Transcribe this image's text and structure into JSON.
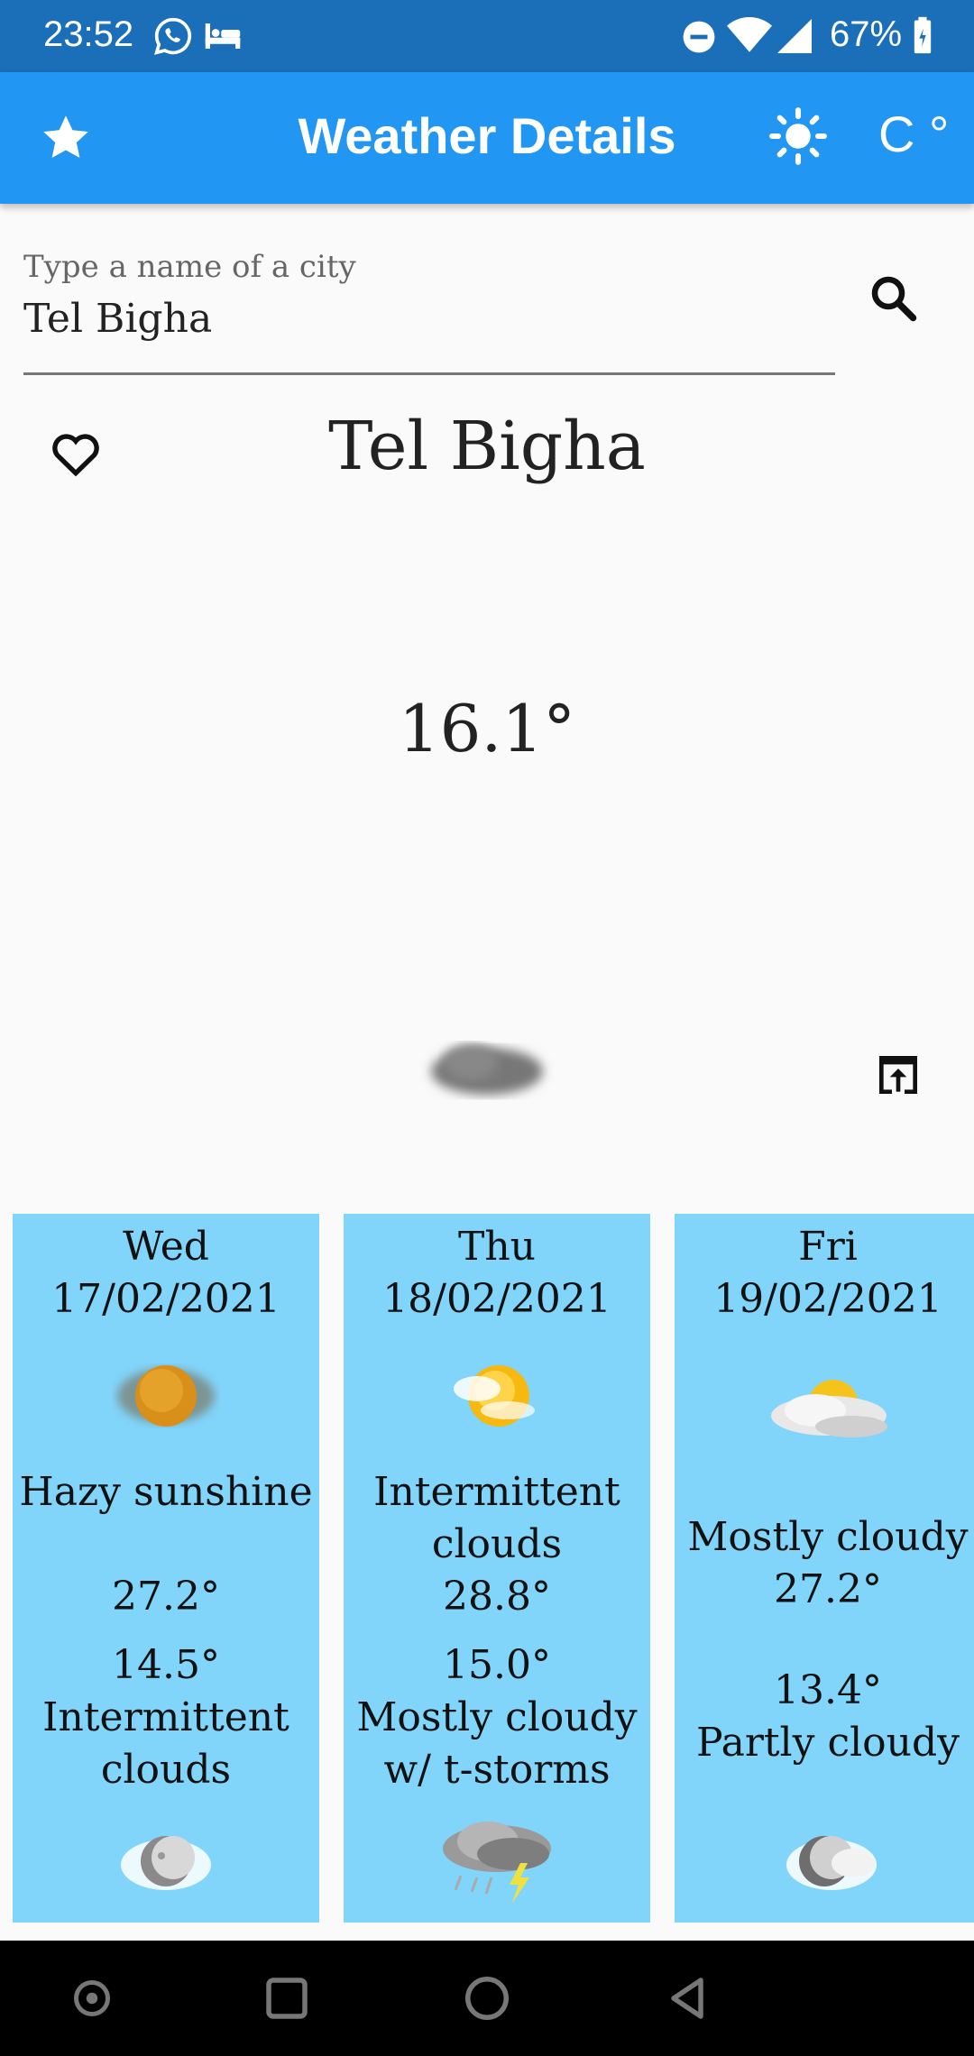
{
  "status_bar": {
    "time": "23:52",
    "battery": "67%",
    "icons": [
      "whatsapp-icon",
      "bed-icon",
      "dnd-icon",
      "wifi-icon",
      "signal-icon",
      "battery-icon"
    ]
  },
  "app_bar": {
    "title": "Weather Details",
    "unit_toggle": "C °",
    "icons": [
      "star-icon",
      "sun-icon"
    ],
    "color": "#2196f3"
  },
  "search": {
    "label": "Type a name of a city",
    "value": "Tel Bigha"
  },
  "current": {
    "city": "Tel Bigha",
    "temperature": "16.1°",
    "condition_icon": "cloudy-icon"
  },
  "forecast": [
    {
      "day": "Wed",
      "date": "17/02/2021",
      "day_desc": "Hazy sunshine",
      "high": "27.2°",
      "low": "14.5°",
      "night_desc": "Intermittent clouds",
      "day_icon": "hazy-sun-icon",
      "night_icon": "moon-cloud-icon"
    },
    {
      "day": "Thu",
      "date": "18/02/2021",
      "day_desc": "Intermittent clouds",
      "high": "28.8°",
      "low": "15.0°",
      "night_desc": "Mostly cloudy w/ t-storms",
      "day_icon": "sun-cloud-icon",
      "night_icon": "thunderstorm-icon"
    },
    {
      "day": "Fri",
      "date": "19/02/2021",
      "day_desc": "Mostly cloudy",
      "high": "27.2°",
      "low": "13.4°",
      "night_desc": "Partly cloudy",
      "day_icon": "cloud-sun-icon",
      "night_icon": "moon-cloud-icon"
    }
  ],
  "card_color": "#81d4fa"
}
